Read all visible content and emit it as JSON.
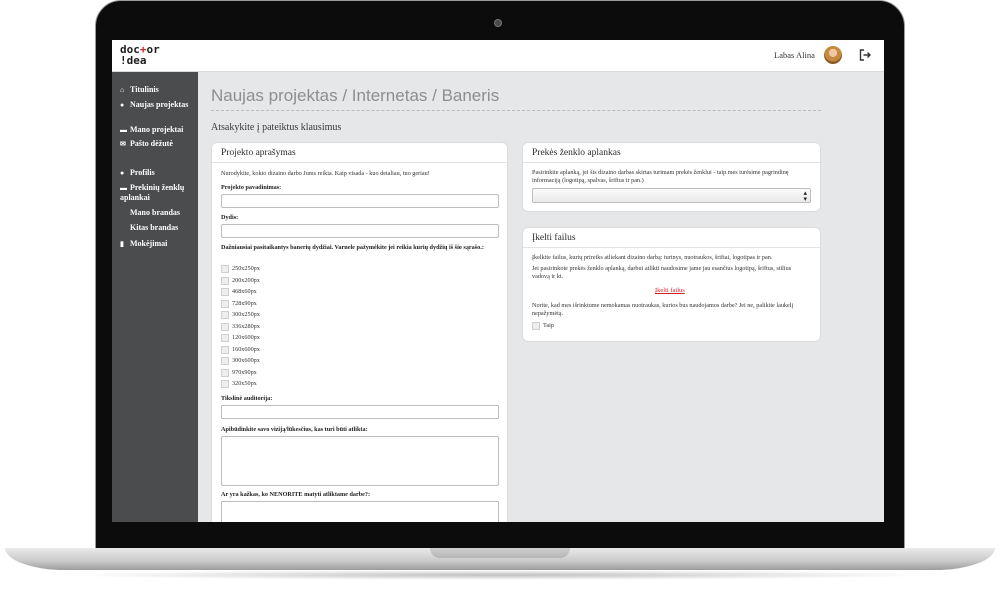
{
  "header": {
    "logo_line1_a": "doc",
    "logo_line1_plus": "+",
    "logo_line1_b": "or",
    "logo_line2": "!dea",
    "greeting": "Labas Alina"
  },
  "sidebar": {
    "items": [
      {
        "icon": "home-icon",
        "glyph": "⌂",
        "label": "Titulinis"
      },
      {
        "icon": "plus-circle-icon",
        "glyph": "●",
        "label": "Naujas projektas"
      },
      {
        "icon": "folder-icon",
        "glyph": "▬",
        "label": "Mano projektai"
      },
      {
        "icon": "envelope-icon",
        "glyph": "✉",
        "label": "Pašto dėžutė"
      },
      {
        "icon": "user-icon",
        "glyph": "●",
        "label": "Profilis"
      },
      {
        "icon": "folder-open-icon",
        "glyph": "▬",
        "label": "Prekinių ženklų aplankai"
      },
      {
        "icon": "",
        "glyph": "",
        "label": "Mano brandas"
      },
      {
        "icon": "",
        "glyph": "",
        "label": "Kitas brandas"
      },
      {
        "icon": "credit-card-icon",
        "glyph": "▮",
        "label": "Mokėjimai"
      }
    ]
  },
  "main": {
    "title": "Naujas projektas / Internetas / Baneris",
    "subtitle": "Atsakykite į pateiktus klausimus"
  },
  "project_card": {
    "title": "Projekto aprašymas",
    "intro": "Nurodykite, kokio dizaino darbo Jums reikia. Kaip visada - kuo detaliau, tuo geriau!",
    "name_label": "Projekto pavadinimas:",
    "size_label": "Dydis:",
    "common_sizes_label": "Dažniausiai pasitaikantys banerių dydžiai. Varnele pažymėkite jei reikia kurių dydžių iš šio sąrašo.:",
    "sizes": [
      "250x250px",
      "200x200px",
      "468x60px",
      "728x90px",
      "300x250px",
      "336x280px",
      "120x600px",
      "160x600px",
      "300x600px",
      "970x90px",
      "320x50px"
    ],
    "audience_label": "Tikslinė auditorija:",
    "vision_label": "Apibūdinkite savo viziją/lūkesčius, kas turi būti atlikta:",
    "dont_want_label": "Ar yra kažkas, ko NENORITE matyti atliktame darbe?:"
  },
  "brand_card": {
    "title": "Prekės ženklo aplankas",
    "text": "Pasirinkite aplanką, jei šis dizaino darbas skirtas turimam prekės ženklui - taip mes turėsime pagrindinę informaciją (logotipą, spalvas, šriftus ir pan.)",
    "select_value": ""
  },
  "upload_card": {
    "title": "Įkelti failus",
    "text1": "Įkelkite failus, kurių prireiks atliekant dizaino darbą: turinys, nuotraukos, šriftai, logotipas ir pan.",
    "text2": "Jei pasirinkote prekės ženklo aplanką, darbui atlikti naudosime jame jau esančius logotipą, šriftus, stilius vadovą ir kt.",
    "upload_link": "Įkelti failus",
    "text3": "Norite, kad mes išrinktume nemokamas nuotraukas, kurios bus naudojamos darbe? Jei ne, palikite laukelį nepažymėtą.",
    "yes_label": "Taip"
  },
  "colors": {
    "accent": "#d2232a",
    "sidebar_bg": "#4b4c4d",
    "content_bg": "#e6e7e8"
  }
}
